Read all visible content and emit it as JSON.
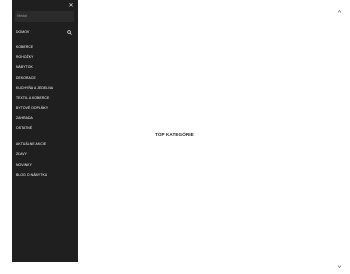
{
  "sidebar": {
    "search": {
      "placeholder": "Hledat"
    },
    "close_icon": "close-icon",
    "search_icon": "search-icon",
    "items": [
      {
        "label": "DOMOV"
      },
      {
        "label": "KOBERCE"
      },
      {
        "label": "ROHOŽKY"
      },
      {
        "label": "NÁBYTOK"
      },
      {
        "label": "DEKORACE"
      },
      {
        "label": "KUCHYŇA A JEDELNA"
      },
      {
        "label": "TEXTIL A KOBERCE"
      },
      {
        "label": "BYTOVÉ DOPLŇKY"
      },
      {
        "label": "ZAHRADA"
      },
      {
        "label": "OSTATNÉ"
      },
      {
        "label": "AKTUÁLNE AKCIE"
      },
      {
        "label": "ZĽAVY"
      },
      {
        "label": "NOVINKY"
      },
      {
        "label": "BLOG O NÁBYTKU"
      }
    ]
  },
  "main": {
    "title": "TOP KATEGÓRIE"
  },
  "colors": {
    "sidebar_bg": "#1f1f1f",
    "page_bg": "#ffffff",
    "menu_text": "#ffffff"
  }
}
